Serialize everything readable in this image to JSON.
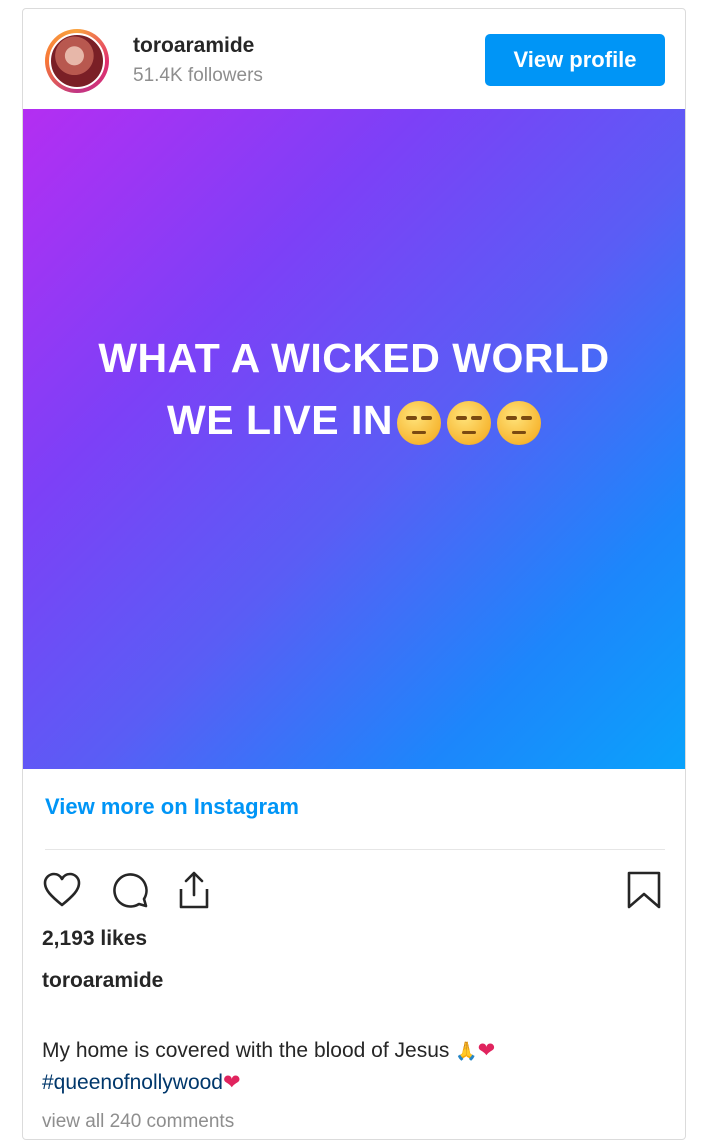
{
  "header": {
    "username": "toroaramide",
    "followers": "51.4K followers",
    "view_profile_label": "View profile"
  },
  "post": {
    "text_line1": "WHAT A WICKED WORLD",
    "text_line2": "WE LIVE IN",
    "emoji_count": 3,
    "gradient_colors": [
      "#b42ef2",
      "#7d40f7",
      "#1d86fb",
      "#0aa2fb"
    ]
  },
  "view_more_label": "View more on Instagram",
  "actions": {
    "like_icon": "heart-outline-icon",
    "comment_icon": "comment-bubble-icon",
    "share_icon": "share-upload-icon",
    "save_icon": "bookmark-icon"
  },
  "likes": "2,193 likes",
  "caption": {
    "username": "toroaramide",
    "text": "My home is covered with the blood of Jesus ",
    "emoji1": "🙏",
    "emoji2": "❤",
    "hashtag": "#queenofnollywood",
    "hashtag_emoji": "❤"
  },
  "comments_peek": "view all 240 comments",
  "colors": {
    "accent": "#0095f6",
    "text": "#262626",
    "muted": "#8e8e8e"
  }
}
